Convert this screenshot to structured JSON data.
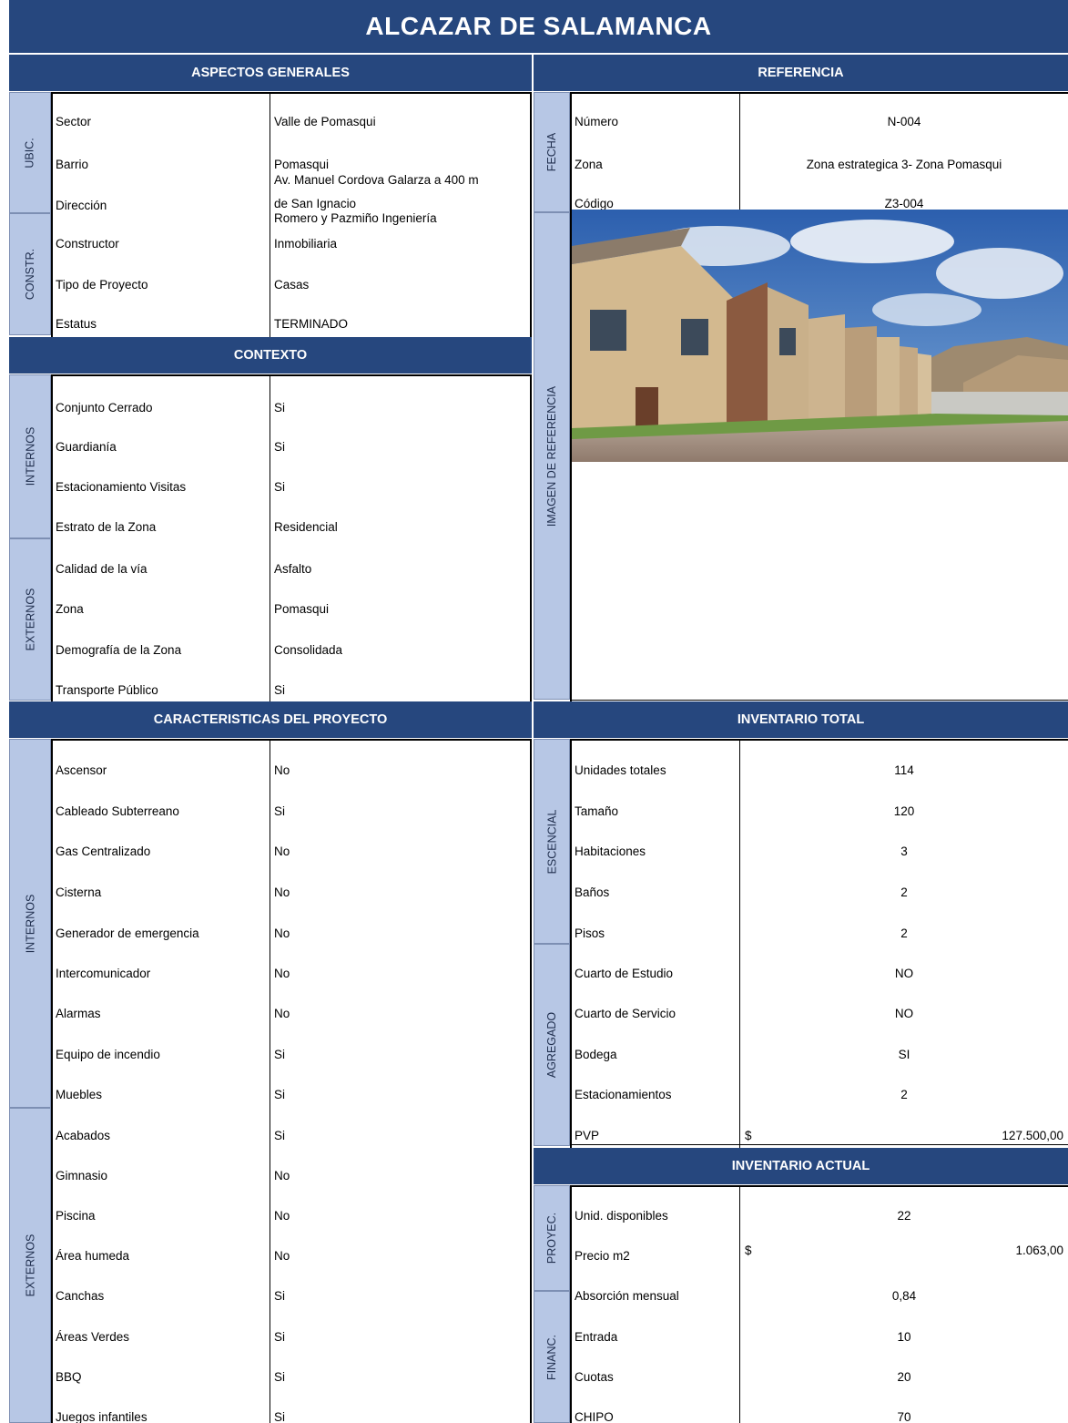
{
  "title": "ALCAZAR DE SALAMANCA",
  "headers": {
    "aspectos_generales": "ASPECTOS GENERALES",
    "referencia": "REFERENCIA",
    "contexto": "CONTEXTO",
    "caracteristicas": "CARACTERISTICAS DEL PROYECTO",
    "inventario_total": "INVENTARIO TOTAL",
    "inventario_actual": "INVENTARIO ACTUAL"
  },
  "side_labels": {
    "ubic": "UBIC.",
    "constr": "CONSTR.",
    "internos": "INTERNOS",
    "externos": "EXTERNOS",
    "fecha": "FECHA",
    "imagen": "IMAGEN DE REFERENCIA",
    "escencial": "ESCENCIAL",
    "agregado": "AGREGADO",
    "proyec": "PROYEC.",
    "financ": "FINANC."
  },
  "general": [
    {
      "label": "Sector",
      "value": "Valle de Pomasqui"
    },
    {
      "label": "Barrio",
      "value": "Pomasqui"
    },
    {
      "label": "Dirección",
      "value_line1": "Av. Manuel Cordova Galarza a 400 m",
      "value_line2": "de San Ignacio"
    },
    {
      "label": "Constructor",
      "value_line1": "Romero y Pazmiño Ingeniería",
      "value_line2": "Inmobiliaria"
    },
    {
      "label": "Tipo de Proyecto",
      "value": "Casas"
    },
    {
      "label": "Estatus",
      "value": "TERMINADO"
    }
  ],
  "contexto_internos": [
    {
      "label": "Conjunto Cerrado",
      "value": "Si"
    },
    {
      "label": "Guardianía",
      "value": "Si"
    },
    {
      "label": "Estacionamiento Visitas",
      "value": "Si"
    },
    {
      "label": "Estrato de la Zona",
      "value": "Residencial"
    }
  ],
  "contexto_externos": [
    {
      "label": "Calidad de la vía",
      "value": "Asfalto"
    },
    {
      "label": "Zona",
      "value": "Pomasqui"
    },
    {
      "label": "Demografía de la Zona",
      "value": "Consolidada"
    },
    {
      "label": "Transporte Público",
      "value": "Si"
    }
  ],
  "referencia": [
    {
      "label": "Número",
      "value": "N-004"
    },
    {
      "label": "Zona",
      "value": "Zona estrategica 3- Zona Pomasqui"
    },
    {
      "label": "Código",
      "value": "Z3-004"
    }
  ],
  "caract_internos": [
    {
      "label": "Ascensor",
      "value": "No"
    },
    {
      "label": "Cableado Subterreano",
      "value": "Si"
    },
    {
      "label": "Gas Centralizado",
      "value": "No"
    },
    {
      "label": "Cisterna",
      "value": "No"
    },
    {
      "label": "Generador de emergencia",
      "value": "No"
    },
    {
      "label": "Intercomunicador",
      "value": "No"
    },
    {
      "label": "Alarmas",
      "value": "No"
    },
    {
      "label": "Equipo de incendio",
      "value": "Si"
    },
    {
      "label": "Muebles",
      "value": "Si"
    },
    {
      "label": "Acabados",
      "value": "Si"
    }
  ],
  "caract_externos": [
    {
      "label": "Gimnasio",
      "value": "No"
    },
    {
      "label": "Piscina",
      "value": "No"
    },
    {
      "label": "Área humeda",
      "value": "No"
    },
    {
      "label": "Canchas",
      "value": "Si"
    },
    {
      "label": "Áreas Verdes",
      "value": "Si"
    },
    {
      "label": "BBQ",
      "value": "Si"
    },
    {
      "label": "Juegos infantiles",
      "value": "Si"
    }
  ],
  "inv_escencial": [
    {
      "label": "Unidades totales",
      "value": "114"
    },
    {
      "label": "Tamaño",
      "value": "120"
    },
    {
      "label": "Habitaciones",
      "value": "3"
    },
    {
      "label": "Baños",
      "value": "2"
    },
    {
      "label": "Pisos",
      "value": "2"
    }
  ],
  "inv_agregado": [
    {
      "label": "Cuarto de Estudio",
      "value": "NO"
    },
    {
      "label": "Cuarto de Servicio",
      "value": "NO"
    },
    {
      "label": "Bodega",
      "value": "SI"
    },
    {
      "label": "Estacionamientos",
      "value": "2"
    }
  ],
  "pvp": {
    "label": "PVP",
    "currency": "$",
    "value": "127.500,00"
  },
  "inv_actual": {
    "disponibles_label": "Unid. disponibles",
    "disponibles_value": "22",
    "precio_label": "Precio m2",
    "precio_currency": "$",
    "precio_value": "1.063,00",
    "absorcion_label": "Absorción mensual",
    "absorcion_value": "0,84",
    "entrada_label": "Entrada",
    "entrada_value": "10",
    "cuotas_label": "Cuotas",
    "cuotas_value": "20",
    "chipo_label": "CHIPO",
    "chipo_value": "70"
  },
  "colors": {
    "band": "#26477e",
    "side": "#b7c7e5"
  }
}
